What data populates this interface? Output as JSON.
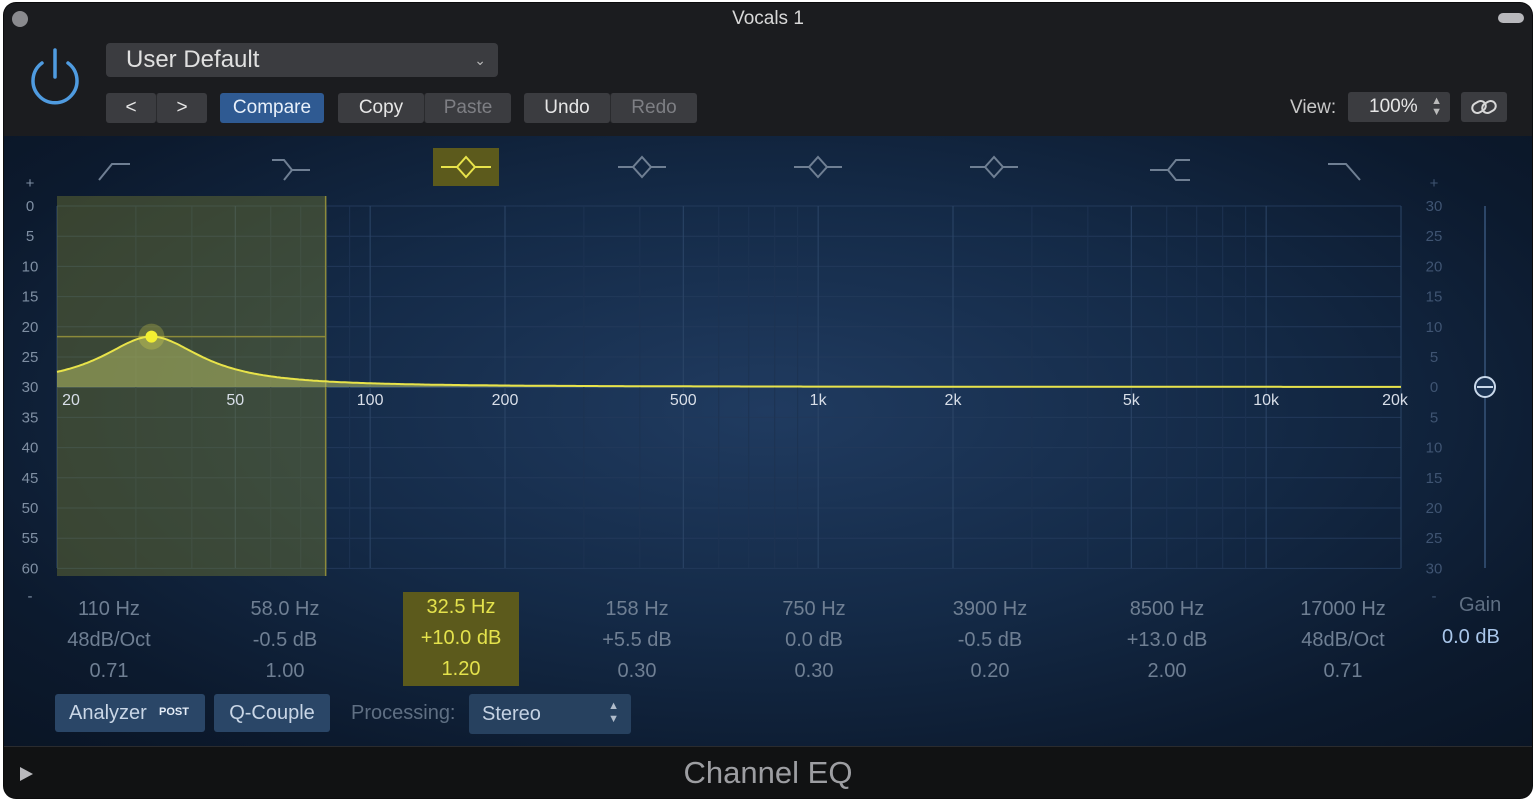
{
  "window": {
    "title": "Vocals 1"
  },
  "header": {
    "preset": "User Default",
    "nav_prev": "<",
    "nav_next": ">",
    "compare": "Compare",
    "copy": "Copy",
    "paste": "Paste",
    "undo": "Undo",
    "redo": "Redo",
    "view_label": "View:",
    "view_value": "100%"
  },
  "graph": {
    "left_scale": [
      "+",
      "0",
      "5",
      "10",
      "15",
      "20",
      "25",
      "30",
      "35",
      "40",
      "45",
      "50",
      "55",
      "60",
      "-"
    ],
    "right_scale": [
      "+",
      "30",
      "25",
      "20",
      "15",
      "10",
      "5",
      "0",
      "5",
      "10",
      "15",
      "20",
      "25",
      "30",
      "-"
    ],
    "freq_labels": [
      "20",
      "50",
      "100",
      "200",
      "500",
      "1k",
      "2k",
      "5k",
      "10k",
      "20k"
    ],
    "selected_band": {
      "freq_hz": 32.5,
      "gain_db": 10.0,
      "q": 1.2
    },
    "output_gain_db": 0.0
  },
  "bands": [
    {
      "freq": "110 Hz",
      "gain": "48dB/Oct",
      "q": "0.71",
      "shape": "lowcut-icon",
      "selected": false
    },
    {
      "freq": "58.0 Hz",
      "gain": "-0.5 dB",
      "q": "1.00",
      "shape": "lowshelf-icon",
      "selected": false
    },
    {
      "freq": "32.5 Hz",
      "gain": "+10.0 dB",
      "q": "1.20",
      "shape": "bell-icon",
      "selected": true
    },
    {
      "freq": "158 Hz",
      "gain": "+5.5 dB",
      "q": "0.30",
      "shape": "bell-icon",
      "selected": false
    },
    {
      "freq": "750 Hz",
      "gain": "0.0 dB",
      "q": "0.30",
      "shape": "bell-icon",
      "selected": false
    },
    {
      "freq": "3900 Hz",
      "gain": "-0.5 dB",
      "q": "0.20",
      "shape": "bell-icon",
      "selected": false
    },
    {
      "freq": "8500 Hz",
      "gain": "+13.0 dB",
      "q": "2.00",
      "shape": "highshelf-icon",
      "selected": false
    },
    {
      "freq": "17000 Hz",
      "gain": "48dB/Oct",
      "q": "0.71",
      "shape": "highcut-icon",
      "selected": false
    }
  ],
  "gain": {
    "label": "Gain",
    "value": "0.0 dB"
  },
  "footer": {
    "analyzer": "Analyzer",
    "analyzer_badge": "POST",
    "qcouple": "Q-Couple",
    "processing_label": "Processing:",
    "processing_value": "Stereo",
    "plugin_name": "Channel EQ"
  },
  "colors": {
    "accent_blue": "#2f5a92",
    "curve_yellow": "#e8e34a",
    "panel_bg": "#142a47"
  }
}
